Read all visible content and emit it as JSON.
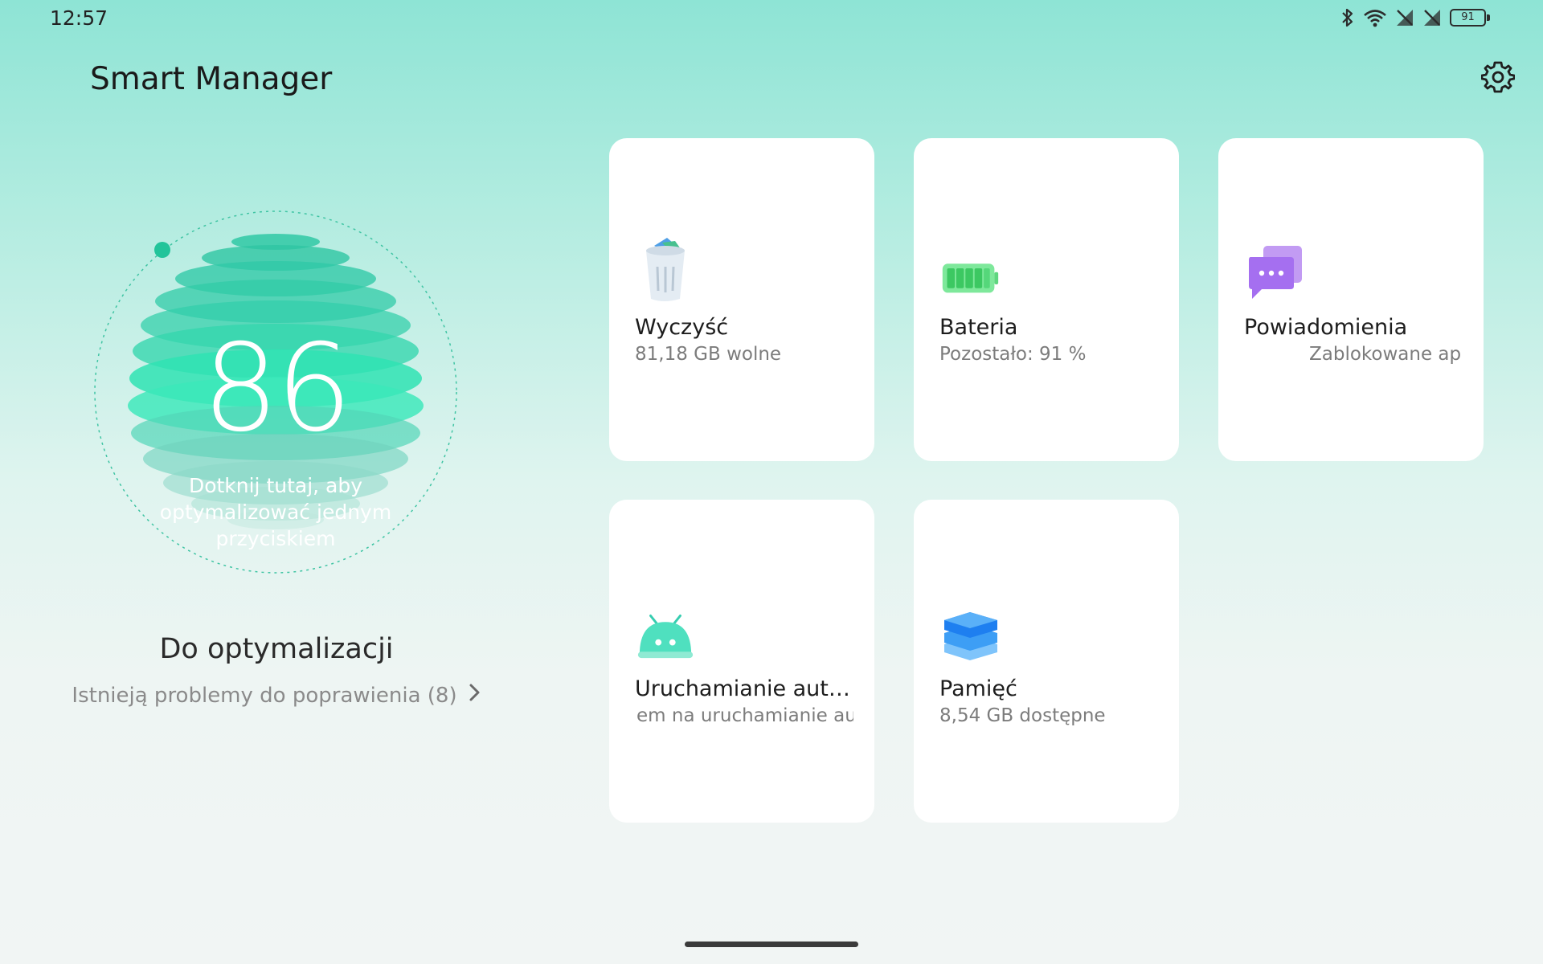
{
  "status_bar": {
    "time": "12:57",
    "battery_level": "91",
    "icons": [
      "bluetooth-icon",
      "wifi-icon",
      "no-sim-icon",
      "no-sim-icon",
      "battery-icon"
    ]
  },
  "header": {
    "title": "Smart Manager",
    "settings_icon": "gear-icon"
  },
  "score": {
    "value": "86",
    "hint": "Dotknij tutaj, aby optymalizować jednym przyciskiem"
  },
  "optimization": {
    "title": "Do optymalizacji",
    "link_text": "Istnieją problemy do poprawienia (8)"
  },
  "cards": [
    {
      "id": "clean",
      "icon": "trash-bin-icon",
      "title": "Wyczyść",
      "subtitle": "81,18 GB wolne"
    },
    {
      "id": "battery",
      "icon": "battery-icon",
      "title": "Bateria",
      "subtitle": "Pozostało: 91 %"
    },
    {
      "id": "notifications",
      "icon": "chat-bubbles-icon",
      "title": "Powiadomienia",
      "subtitle": "Zablokowane apli"
    },
    {
      "id": "autostart",
      "icon": "android-icon",
      "title": "Uruchamianie auto...",
      "subtitle": "em na uruchamianie auto"
    },
    {
      "id": "memory",
      "icon": "layers-icon",
      "title": "Pamięć",
      "subtitle": "8,54 GB dostępne"
    }
  ],
  "colors": {
    "accent": "#2fd3a8",
    "background_top": "#8ee4d5",
    "card_background": "#ffffff"
  }
}
